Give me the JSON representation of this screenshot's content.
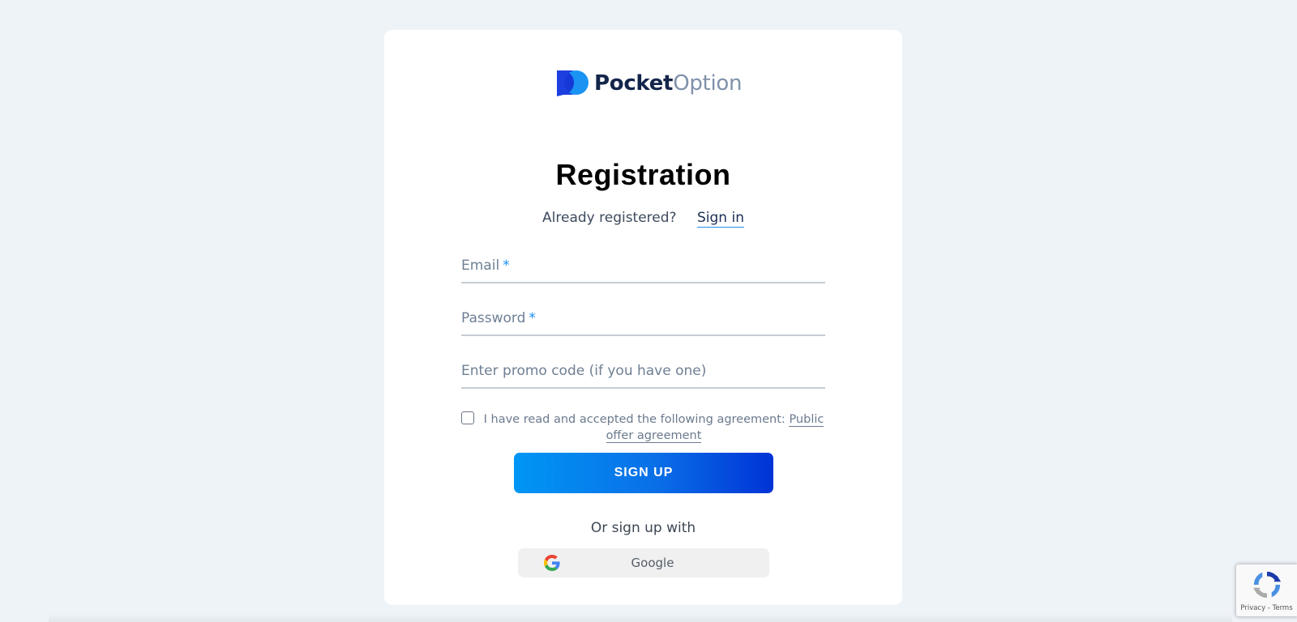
{
  "brand": {
    "name_bold": "Pocket",
    "name_light": "Option",
    "logo_icon": "pocket-option-logo-icon",
    "colors": {
      "dark": "#13254a",
      "light": "#7e91aa",
      "blue": "#1a8ff2",
      "deep_blue": "#0033d6"
    }
  },
  "form": {
    "title": "Registration",
    "already_text": "Already registered?",
    "signin_label": "Sign in",
    "email_label": "Email",
    "password_label": "Password",
    "required_mark": "*",
    "promo_label": "Enter promo code (if you have one)",
    "agreement_text": "I have read and accepted the following agreement:",
    "agreement_link": "Public offer agreement",
    "agreement_checked": false,
    "signup_label": "SIGN UP",
    "or_text": "Or sign up with",
    "google_label": "Google",
    "google_icon": "google-g-icon"
  },
  "recaptcha": {
    "links": "Privacy - Terms",
    "icon": "recaptcha-icon"
  }
}
